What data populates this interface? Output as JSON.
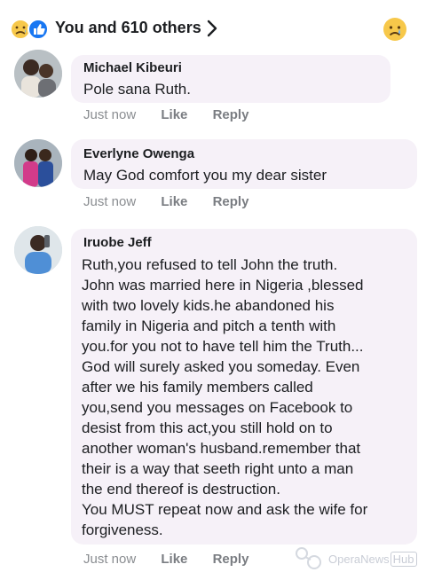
{
  "reactions": {
    "count_text": "You and 610 others",
    "icons": [
      "sad-emoji-icon",
      "like-icon"
    ]
  },
  "comments": [
    {
      "author": "Michael Kibeuri",
      "text": "Pole sana Ruth.",
      "time": "Just now",
      "like_label": "Like",
      "reply_label": "Reply"
    },
    {
      "author": "Everlyne Owenga",
      "text": "May God comfort you my dear sister",
      "time": "Just now",
      "like_label": "Like",
      "reply_label": "Reply"
    },
    {
      "author": "Iruobe Jeff",
      "lines": [
        "Ruth,you refused to tell John the truth.",
        "John was married here in Nigeria ,blessed",
        "with two lovely kids.he abandoned his",
        "family in Nigeria and pitch a tenth with",
        "you.for you not to have tell him the Truth...",
        "God will surely asked you someday. Even",
        "after we his family members called",
        "you,send you messages on Facebook to",
        "desist from this act,you still hold on to",
        "another woman's husband.remember that",
        "their is a way that seeth right unto a man",
        "the end thereof is destruction.",
        "You MUST repeat now and ask the wife for",
        "forgiveness."
      ],
      "time": "Just now",
      "like_label": "Like",
      "reply_label": "Reply"
    }
  ],
  "watermark": {
    "brand": "OperaNews",
    "suffix": "Hub"
  }
}
